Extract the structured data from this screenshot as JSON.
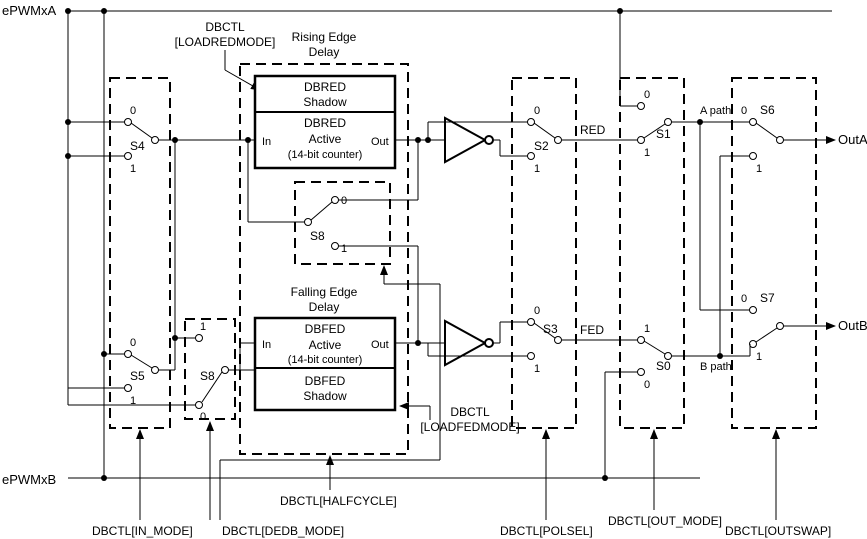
{
  "inputs": {
    "a": "ePWMxA",
    "b": "ePWMxB"
  },
  "outputs": {
    "a": "OutA",
    "b": "OutB"
  },
  "paths": {
    "a": "A path",
    "b": "B path"
  },
  "red_signal": "RED",
  "fed_signal": "FED",
  "rising": {
    "title": "Rising Edge\nDelay",
    "shadow": "DBRED\nShadow",
    "active_name": "DBRED",
    "active_type": "Active",
    "active_note": "(14-bit counter)",
    "in": "In",
    "out": "Out"
  },
  "falling": {
    "title": "Falling Edge\nDelay",
    "shadow": "DBFED\nShadow",
    "active_name": "DBFED",
    "active_type": "Active",
    "active_note": "(14-bit counter)",
    "in": "In",
    "out": "Out"
  },
  "switches": {
    "s0": "S0",
    "s1": "S1",
    "s2": "S2",
    "s3": "S3",
    "s4": "S4",
    "s5": "S5",
    "s6": "S6",
    "s7": "S7",
    "s8": "S8",
    "s8b": "S8",
    "zero": "0",
    "one": "1"
  },
  "ctrl": {
    "loadred": "DBCTL\n[LOADREDMODE]",
    "loadfed": "DBCTL\n[LOADFEDMODE]",
    "in_mode": "DBCTL[IN_MODE]",
    "dedb_mode": "DBCTL[DEDB_MODE]",
    "halfcycle": "DBCTL[HALFCYCLE]",
    "polsel": "DBCTL[POLSEL]",
    "out_mode": "DBCTL[OUT_MODE]",
    "outswap": "DBCTL[OUTSWAP]"
  }
}
